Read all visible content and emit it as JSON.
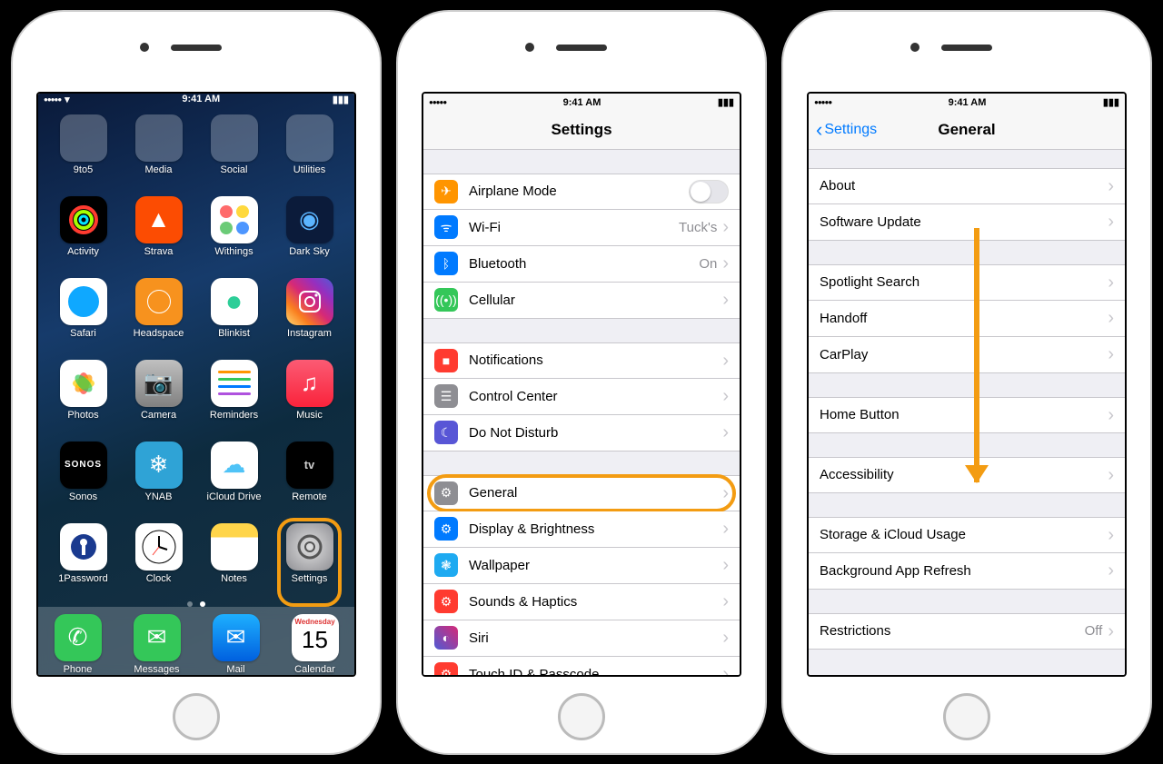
{
  "status": {
    "time": "9:41 AM"
  },
  "home": {
    "folders": [
      "9to5",
      "Media",
      "Social",
      "Utilities"
    ],
    "apps_row2": [
      {
        "label": "Activity",
        "bg": "#000"
      },
      {
        "label": "Strava",
        "bg": "#fc4c02"
      },
      {
        "label": "Withings",
        "bg": "#fff"
      },
      {
        "label": "Dark Sky",
        "bg": "#0b1b3a"
      }
    ],
    "apps_row3": [
      {
        "label": "Safari",
        "bg": "#fff"
      },
      {
        "label": "Headspace",
        "bg": "#f7921e"
      },
      {
        "label": "Blinkist",
        "bg": "#fff"
      },
      {
        "label": "Instagram",
        "bg": "linear-gradient(45deg,#feda75,#d62976,#4f5bd5)"
      }
    ],
    "apps_row4": [
      {
        "label": "Photos",
        "bg": "#fff"
      },
      {
        "label": "Camera",
        "bg": "#8e8e93"
      },
      {
        "label": "Reminders",
        "bg": "#fff"
      },
      {
        "label": "Music",
        "bg": "linear-gradient(#fb5b74,#fa233b)"
      }
    ],
    "apps_row5": [
      {
        "label": "Sonos",
        "bg": "#000"
      },
      {
        "label": "YNAB",
        "bg": "#2fa3d6"
      },
      {
        "label": "iCloud Drive",
        "bg": "#fff"
      },
      {
        "label": "Remote",
        "bg": "#000"
      }
    ],
    "apps_row6": [
      {
        "label": "1Password",
        "bg": "#fff"
      },
      {
        "label": "Clock",
        "bg": "#fff"
      },
      {
        "label": "Notes",
        "bg": "linear-gradient(#ffd54a 28%,#fff 28%)"
      },
      {
        "label": "Settings",
        "bg": "#8e8e93"
      }
    ],
    "dock": [
      {
        "label": "Phone",
        "bg": "#34c759"
      },
      {
        "label": "Messages",
        "bg": "#34c759"
      },
      {
        "label": "Mail",
        "bg": "linear-gradient(#1e90ff,#0060df)"
      },
      {
        "label": "Calendar",
        "bg": "#fff",
        "cal_day": "Wednesday",
        "cal_num": "15"
      }
    ]
  },
  "settings": {
    "title": "Settings",
    "g1": [
      {
        "label": "Airplane Mode",
        "bg": "#ff9500",
        "switch": true
      },
      {
        "label": "Wi-Fi",
        "bg": "#007aff",
        "detail": "Tuck's"
      },
      {
        "label": "Bluetooth",
        "bg": "#007aff",
        "detail": "On"
      },
      {
        "label": "Cellular",
        "bg": "#34c759"
      }
    ],
    "g2": [
      {
        "label": "Notifications",
        "bg": "#ff3b30"
      },
      {
        "label": "Control Center",
        "bg": "#8e8e93"
      },
      {
        "label": "Do Not Disturb",
        "bg": "#5856d6"
      }
    ],
    "g3": [
      {
        "label": "General",
        "bg": "#8e8e93",
        "highlight": true
      },
      {
        "label": "Display & Brightness",
        "bg": "#007aff"
      },
      {
        "label": "Wallpaper",
        "bg": "#1eaaf1"
      },
      {
        "label": "Sounds & Haptics",
        "bg": "#ff3b30"
      },
      {
        "label": "Siri",
        "bg": "linear-gradient(45deg,#4f5bd5,#d62976)"
      },
      {
        "label": "Touch ID & Passcode",
        "bg": "#ff3b30"
      }
    ]
  },
  "general": {
    "back": "Settings",
    "title": "General",
    "g1": [
      {
        "label": "About"
      },
      {
        "label": "Software Update"
      }
    ],
    "g2": [
      {
        "label": "Spotlight Search"
      },
      {
        "label": "Handoff"
      },
      {
        "label": "CarPlay"
      }
    ],
    "g3": [
      {
        "label": "Home Button"
      }
    ],
    "g4": [
      {
        "label": "Accessibility"
      }
    ],
    "g5": [
      {
        "label": "Storage & iCloud Usage"
      },
      {
        "label": "Background App Refresh"
      }
    ],
    "g6": [
      {
        "label": "Restrictions",
        "detail": "Off"
      }
    ]
  }
}
